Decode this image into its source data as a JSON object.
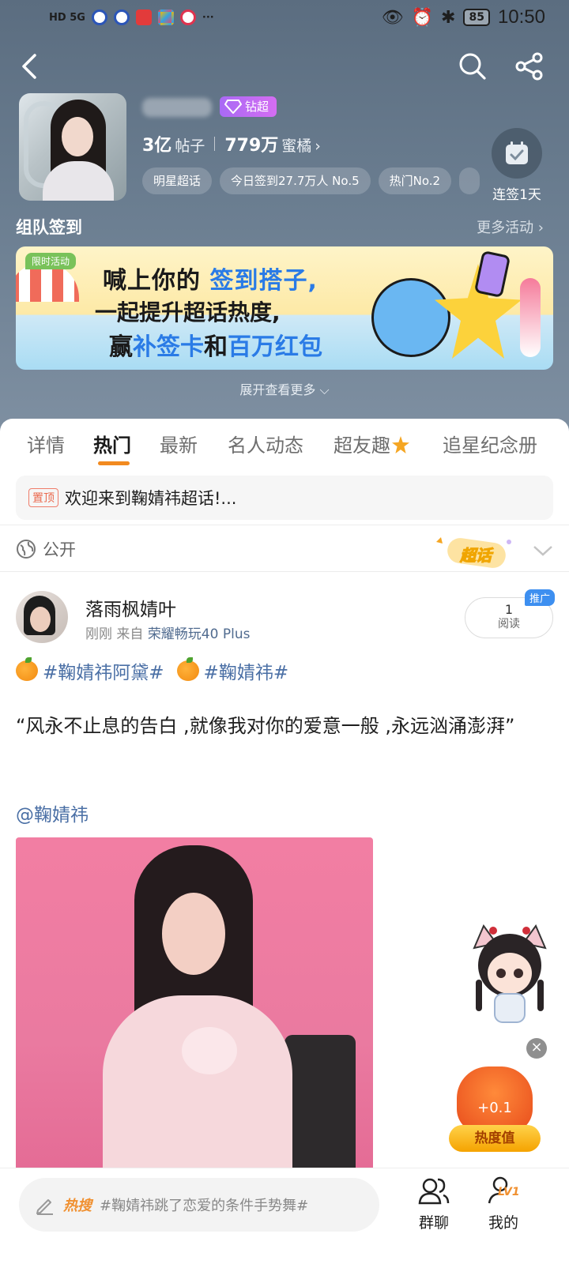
{
  "status_bar": {
    "network": "HD 5G",
    "battery": "85",
    "time": "10:50"
  },
  "topic": {
    "badge": "钻超",
    "posts_count": "3亿",
    "posts_label": "帖子",
    "fans_count": "779万",
    "fans_label": "蜜橘",
    "tags": [
      "明星超话",
      "今日签到27.7万人 No.5",
      "热门No.2"
    ],
    "checkin_label": "连签1天"
  },
  "team": {
    "title": "组队签到",
    "more": "更多活动",
    "banner": {
      "limited": "限时活动",
      "line1_prefix": "喊上你的",
      "line1_highlight": "签到搭子,",
      "line2": "一起提升超话热度,",
      "line3_a": "赢",
      "line3_b": "补签卡",
      "line3_c": "和",
      "line3_d": "百万红包"
    },
    "expand": "展开查看更多"
  },
  "tabs": [
    "详情",
    "热门",
    "最新",
    "名人动态",
    "超友趣",
    "追星纪念册"
  ],
  "active_tab": "热门",
  "pinned": {
    "badge": "置顶",
    "text": "欢迎来到鞠婧祎超话!..."
  },
  "visibility": "公开",
  "sticker_text": "超话",
  "post": {
    "user": "落雨枫婧叶",
    "time": "刚刚",
    "from_label": "来自",
    "device": "荣耀畅玩40 Plus",
    "reads": "1",
    "reads_label": "阅读",
    "promo": "推广",
    "tag1": "#鞠婧祎阿黛#",
    "tag2": "#鞠婧祎#",
    "quote": "“风永不止息的告白 ,就像我对你的爱意一般 ,永远汹涌澎湃”",
    "mention": "@鞠婧祎"
  },
  "floating": {
    "heat_plus": "+0.1",
    "heat_label": "热度值",
    "close": "×"
  },
  "bottom": {
    "hot_label": "热搜",
    "hot_text": "#鞠婧祎跳了恋爱的条件手势舞#",
    "group_chat": "群聊",
    "mine": "我的",
    "level": "LV1"
  },
  "colors": {
    "accent": "#f28a1f",
    "link": "#4a6fa5",
    "header_bg": "#6a7d90"
  }
}
